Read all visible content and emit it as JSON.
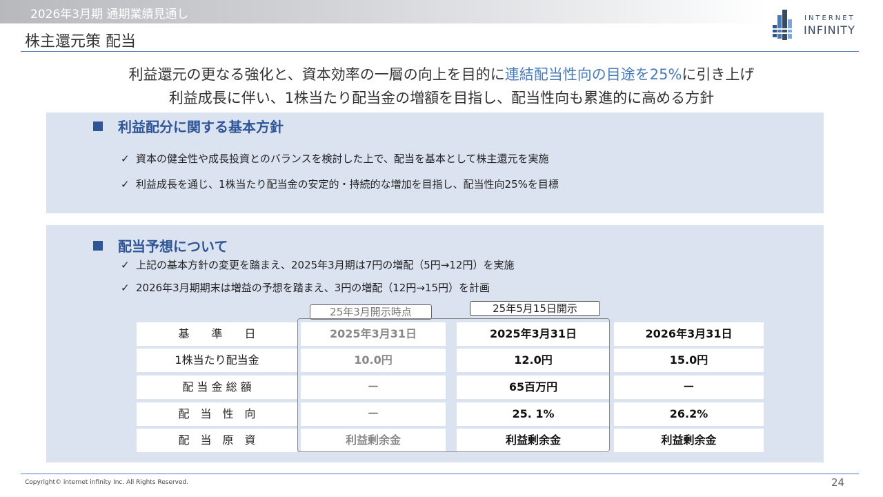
{
  "header": {
    "period_title": "2026年3月期  通期業績見通し",
    "page_title": "株主還元策  配当"
  },
  "logo": {
    "line1": "INTERNET",
    "line2": "INFINITY",
    "color": "#3a4a60"
  },
  "lead": {
    "line1_prefix": "利益還元の更なる強化と、資本効率の一層の向上を目的に",
    "line1_highlight": "連結配当性向の目途を25%",
    "line1_suffix": "に引き上げ",
    "line2": "利益成長に伴い、1株当たり配当金の増額を目指し、配当性向も累進的に高める方針"
  },
  "section1": {
    "heading": "利益配分に関する基本方針",
    "bullets": [
      "資本の健全性や成長投資とのバランスを検討した上で、配当を基本として株主還元を実施",
      "利益成長を通じ、1株当たり配当金の安定的・持続的な増加を目指し、配当性向25%を目標"
    ]
  },
  "section2": {
    "heading": "配当予想について",
    "bullets": [
      "上記の基本方針の変更を踏まえ、2025年3月期は7円の増配（5円→12円）を実施",
      "2026年3月期期末は増益の予想を踏まえ、3円の増配（12円→15円）を計画"
    ]
  },
  "table": {
    "tag_old": "25年3月開示時点",
    "tag_new": "25年5月15日開示",
    "rows": [
      [
        "基　　準　　日",
        "2025年3月31日",
        "2025年3月31日",
        "2026年3月31日"
      ],
      [
        "1株当たり配当金",
        "10.0円",
        "12.0円",
        "15.0円"
      ],
      [
        "配 当 金 総 額",
        "ー",
        "65百万円",
        "ー"
      ],
      [
        "配　当　性　向",
        "ー",
        "25. 1%",
        "26.2%"
      ],
      [
        "配　当　原　資",
        "利益剰余金",
        "利益剰余金",
        "利益剰余金"
      ]
    ]
  },
  "colors": {
    "accent": "#2f5597",
    "highlight_text": "#4a7ab8",
    "panel_bg": "#dbe3f0"
  },
  "footer": {
    "copyright": "Copyright© internet infinity Inc. All Rights Reserved.",
    "page_number": "24"
  }
}
